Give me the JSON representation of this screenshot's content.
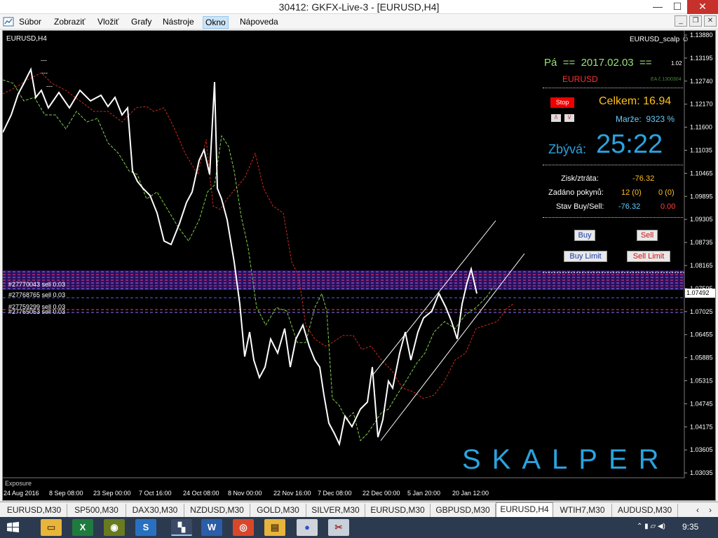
{
  "window": {
    "title": "30412: GKFX-Live-3 - [EURUSD,H4]",
    "minimize_glyph": "—",
    "maximize_glyph": "☐",
    "close_glyph": "✕"
  },
  "menu": {
    "items": [
      "Súbor",
      "Zobraziť",
      "Vložiť",
      "Grafy",
      "Nástroje",
      "Okno",
      "Nápoveda"
    ],
    "active_index": 5,
    "mdi_buttons": [
      "_",
      "❐",
      "✕"
    ]
  },
  "chart": {
    "symbol_label": "EURUSD,H4",
    "ea_name": "EURUSD_scalp",
    "ea_smiley": "☺",
    "current_price": "1.07492",
    "price_axis": [
      "1.13880",
      "1.13195",
      "1.12740",
      "1.12170",
      "1.11600",
      "1.11035",
      "1.10465",
      "1.09895",
      "1.09305",
      "1.08735",
      "1.08165",
      "1.07595",
      "1.07025",
      "1.06455",
      "1.05885",
      "1.05315",
      "1.04745",
      "1.04175",
      "1.03605",
      "1.03035"
    ],
    "time_axis": [
      "24 Aug 2016",
      "8 Sep 08:00",
      "23 Sep 00:00",
      "7 Oct 16:00",
      "24 Oct 08:00",
      "8 Nov 00:00",
      "22 Nov 16:00",
      "7 Dec 08:00",
      "22 Dec 00:00",
      "5 Jan 20:00",
      "20 Jan 12:00"
    ],
    "order_labels": [
      "#27770043 sell 0.03",
      "#27768765 sell 0.03",
      "#27759299 sell 0.03",
      "#27765053 sell 0.03"
    ],
    "short_dashes": [
      "---",
      "---",
      "---"
    ],
    "exposure_label": "Exposure",
    "watermark": "SKALPER",
    "colors": {
      "price_line": "#ffffff",
      "green_line": "#7fd04a",
      "red_line": "#d42a1a",
      "channel": "#ffffff",
      "watermark": "#29a3e0"
    }
  },
  "panel": {
    "day_label": "Pá",
    "eq_left": "==",
    "date": "2017.02.03",
    "eq_right": "==",
    "version": "1.02",
    "symbol": "EURUSD",
    "ea_id": "EA č.1300304",
    "stop_button": "Stop",
    "arrow_up": "/\\",
    "arrow_down": "\\/",
    "total_label": "Celkem:",
    "total_value": "16.94",
    "margin_label": "Marže:",
    "margin_value": "9323 %",
    "remaining_label": "Zbývá:",
    "remaining_value": "25:22",
    "pl_label": "Zisk/ztráta:",
    "pl_value": "-76.32",
    "orders_label": "Zadáno pokynů:",
    "orders_buy": "12 (0)",
    "orders_sell": "0 (0)",
    "state_label": "Stav Buy/Sell:",
    "state_buy": "-76.32",
    "state_sell": "0.00",
    "buy_button": "Buy",
    "sell_button": "Sell",
    "buy_limit_button": "Buy Limit",
    "sell_limit_button": "Sell Limit"
  },
  "tabs": {
    "items": [
      "EURUSD,M30",
      "SP500,M30",
      "DAX30,M30",
      "NZDUSD,M30",
      "GOLD,M30",
      "SILVER,M30",
      "EURUSD,M30",
      "GBPUSD,M30",
      "EURUSD,H4",
      "WTIH7,M30",
      "AUDUSD,M30"
    ],
    "active_index": 8,
    "scroll_left": "‹",
    "scroll_right": "›"
  },
  "taskbar": {
    "icons": [
      "windows-start",
      "file-explorer",
      "excel",
      "camera-app",
      "metatrader",
      "word",
      "chrome",
      "explorer-folder",
      "skype",
      "paint-app",
      "snipping-tool"
    ],
    "clock": "9:35"
  }
}
